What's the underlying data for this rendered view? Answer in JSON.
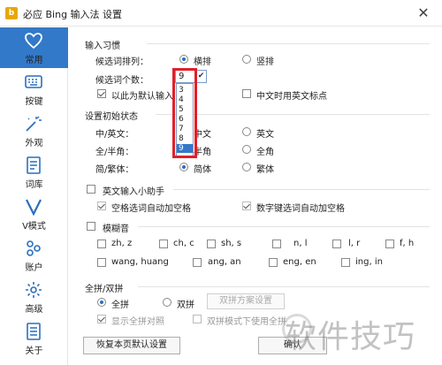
{
  "window": {
    "title": "必应 Bing 输入法 设置",
    "logo_letter": "b"
  },
  "sidebar": {
    "items": [
      {
        "label": "常用",
        "icon": "heart-icon"
      },
      {
        "label": "按键",
        "icon": "keyboard-icon"
      },
      {
        "label": "外观",
        "icon": "appearance-icon"
      },
      {
        "label": "词库",
        "icon": "dictionary-icon"
      },
      {
        "label": "V模式",
        "icon": "v-mode-icon"
      },
      {
        "label": "账户",
        "icon": "account-icon"
      },
      {
        "label": "高级",
        "icon": "gear-icon"
      },
      {
        "label": "关于",
        "icon": "about-icon"
      }
    ]
  },
  "habits": {
    "title": "输入习惯",
    "candidate_layout_label": "候选词排列：",
    "horizontal": "横排",
    "vertical": "竖排",
    "candidate_count_label": "候选词个数：",
    "candidate_count_value": "9",
    "options": [
      "3",
      "4",
      "5",
      "6",
      "7",
      "8",
      "9"
    ],
    "default_input": "以此为默认输入",
    "english_punct": "中文时用英文标点"
  },
  "initial": {
    "title": "设置初始状态",
    "cn_en_label": "中/英文：",
    "cn": "中文",
    "en": "英文",
    "width_label": "全/半角：",
    "half": "半角",
    "full": "全角",
    "script_label": "简/繁体：",
    "simplified": "简体",
    "traditional": "繁体"
  },
  "english_helper": {
    "title": "英文输入小助手",
    "auto_space_candidate": "空格选词自动加空格",
    "auto_space_number": "数字键选词自动加空格"
  },
  "fuzzy": {
    "title": "模糊音",
    "row1": [
      "zh, z",
      "ch, c",
      "sh, s",
      "n, l",
      "l, r",
      "f, h"
    ],
    "row2": [
      "wang, huang",
      "ang, an",
      "eng, en",
      "ing, in"
    ]
  },
  "pinyin": {
    "title": "全拼/双拼",
    "full": "全拼",
    "double": "双拼",
    "scheme_button": "双拼方案设置",
    "show_full_pinyin": "显示全拼对照",
    "double_mode_full": "双拼模式下使用全拼"
  },
  "footer": {
    "restore_button": "恢复本页默认设置",
    "ok_button": "确认"
  },
  "watermark": {
    "text": "软件技巧"
  },
  "colors": {
    "accent": "#3379c9",
    "highlight": "#e0202a"
  }
}
